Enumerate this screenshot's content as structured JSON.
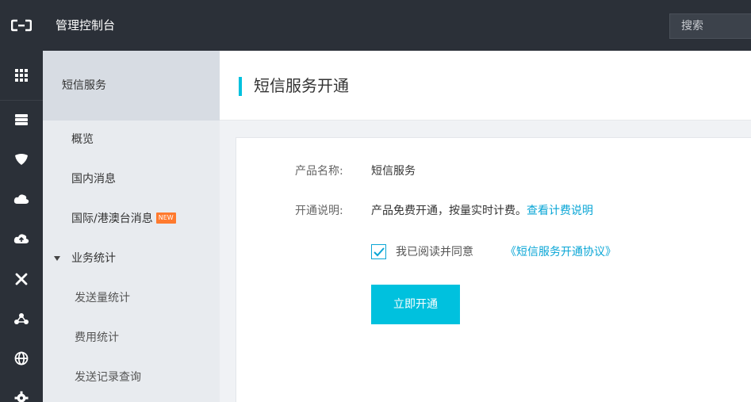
{
  "topbar": {
    "logo_icon": "aliyun-logo-icon",
    "title": "管理控制台",
    "search_placeholder": "搜索"
  },
  "rail": {
    "icons": [
      "grid-icon",
      "database-icon",
      "shield-icon",
      "cloud-icon",
      "cloud-upload-icon",
      "cross-tools-icon",
      "nodes-icon",
      "globe-icon",
      "gear-icon"
    ]
  },
  "sidebar": {
    "title": "短信服务",
    "items": [
      {
        "label": "概览"
      },
      {
        "label": "国内消息"
      },
      {
        "label": "国际/港澳台消息",
        "badge": "NEW"
      },
      {
        "label": "业务统计",
        "expanded": true
      },
      {
        "label": "发送量统计"
      },
      {
        "label": "费用统计"
      },
      {
        "label": "发送记录查询"
      }
    ]
  },
  "main": {
    "title": "短信服务开通",
    "product_label": "产品名称:",
    "product_value": "短信服务",
    "desc_label": "开通说明:",
    "desc_value": "产品免费开通，按量实时计费。",
    "desc_link": "查看计费说明",
    "agree_text": "我已阅读并同意",
    "agree_link": "《短信服务开通协议》",
    "agree_checked": true,
    "open_button": "立即开通"
  },
  "colors": {
    "topbar_bg": "#2b3038",
    "accent": "#00c1de",
    "link": "#0aa6d6",
    "badge": "#ff7a2e"
  }
}
